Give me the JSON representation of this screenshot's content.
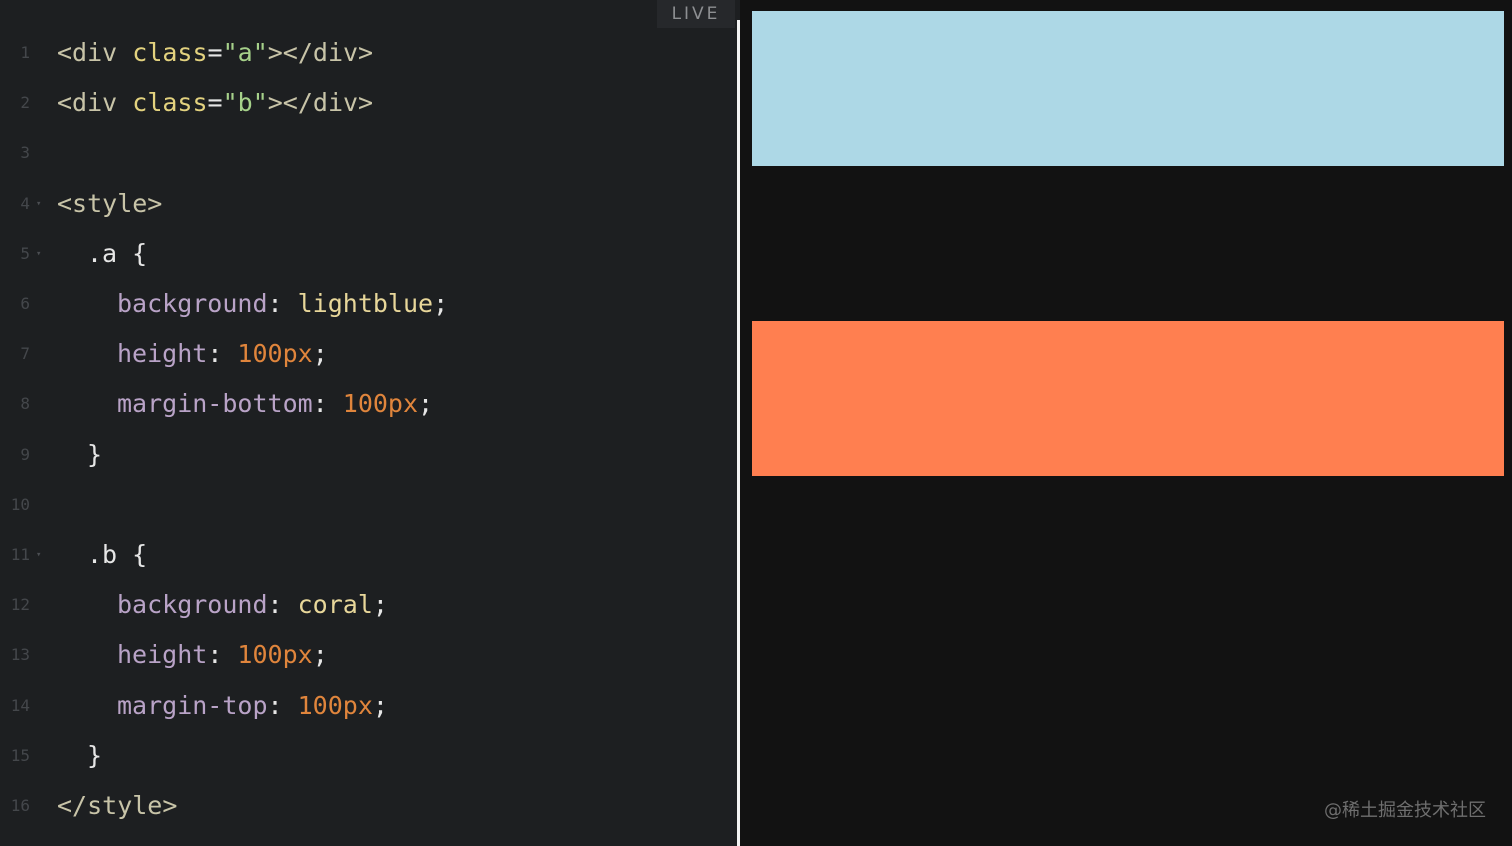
{
  "editor": {
    "live_label": "LIVE",
    "lines": [
      {
        "num": "1",
        "fold": "",
        "indent": 0,
        "tokens": [
          [
            "tag",
            "<div "
          ],
          [
            "attr",
            "class"
          ],
          [
            "punc",
            "="
          ],
          [
            "str",
            "\"a\""
          ],
          [
            "tag",
            "></div>"
          ]
        ]
      },
      {
        "num": "2",
        "fold": "",
        "indent": 0,
        "tokens": [
          [
            "tag",
            "<div "
          ],
          [
            "attr",
            "class"
          ],
          [
            "punc",
            "="
          ],
          [
            "str",
            "\"b\""
          ],
          [
            "tag",
            "></div>"
          ]
        ]
      },
      {
        "num": "3",
        "fold": "",
        "indent": 0,
        "tokens": []
      },
      {
        "num": "4",
        "fold": "▾",
        "indent": 0,
        "tokens": [
          [
            "tag",
            "<style>"
          ]
        ]
      },
      {
        "num": "5",
        "fold": "▾",
        "indent": 1,
        "tokens": [
          [
            "sel",
            ".a "
          ],
          [
            "punc",
            "{"
          ]
        ]
      },
      {
        "num": "6",
        "fold": "",
        "indent": 2,
        "tokens": [
          [
            "prop",
            "background"
          ],
          [
            "punc",
            ": "
          ],
          [
            "val",
            "lightblue"
          ],
          [
            "punc",
            ";"
          ]
        ]
      },
      {
        "num": "7",
        "fold": "",
        "indent": 2,
        "tokens": [
          [
            "prop",
            "height"
          ],
          [
            "punc",
            ": "
          ],
          [
            "num",
            "100px"
          ],
          [
            "punc",
            ";"
          ]
        ]
      },
      {
        "num": "8",
        "fold": "",
        "indent": 2,
        "tokens": [
          [
            "prop",
            "margin-bottom"
          ],
          [
            "punc",
            ": "
          ],
          [
            "num",
            "100px"
          ],
          [
            "punc",
            ";"
          ]
        ]
      },
      {
        "num": "9",
        "fold": "",
        "indent": 1,
        "tokens": [
          [
            "punc",
            "}"
          ]
        ]
      },
      {
        "num": "10",
        "fold": "",
        "indent": 0,
        "tokens": []
      },
      {
        "num": "11",
        "fold": "▾",
        "indent": 1,
        "tokens": [
          [
            "sel",
            ".b "
          ],
          [
            "punc",
            "{"
          ]
        ]
      },
      {
        "num": "12",
        "fold": "",
        "indent": 2,
        "tokens": [
          [
            "prop",
            "background"
          ],
          [
            "punc",
            ": "
          ],
          [
            "val",
            "coral"
          ],
          [
            "punc",
            ";"
          ]
        ]
      },
      {
        "num": "13",
        "fold": "",
        "indent": 2,
        "tokens": [
          [
            "prop",
            "height"
          ],
          [
            "punc",
            ": "
          ],
          [
            "num",
            "100px"
          ],
          [
            "punc",
            ";"
          ]
        ]
      },
      {
        "num": "14",
        "fold": "",
        "indent": 2,
        "tokens": [
          [
            "prop",
            "margin-top"
          ],
          [
            "punc",
            ": "
          ],
          [
            "num",
            "100px"
          ],
          [
            "punc",
            ";"
          ]
        ]
      },
      {
        "num": "15",
        "fold": "",
        "indent": 1,
        "tokens": [
          [
            "punc",
            "}"
          ]
        ]
      },
      {
        "num": "16",
        "fold": "",
        "indent": 0,
        "tokens": [
          [
            "tag",
            "</style>"
          ]
        ]
      }
    ]
  },
  "preview": {
    "box_a_color": "#add8e6",
    "box_b_color": "#ff7f50",
    "watermark": "@稀土掘金技术社区"
  }
}
